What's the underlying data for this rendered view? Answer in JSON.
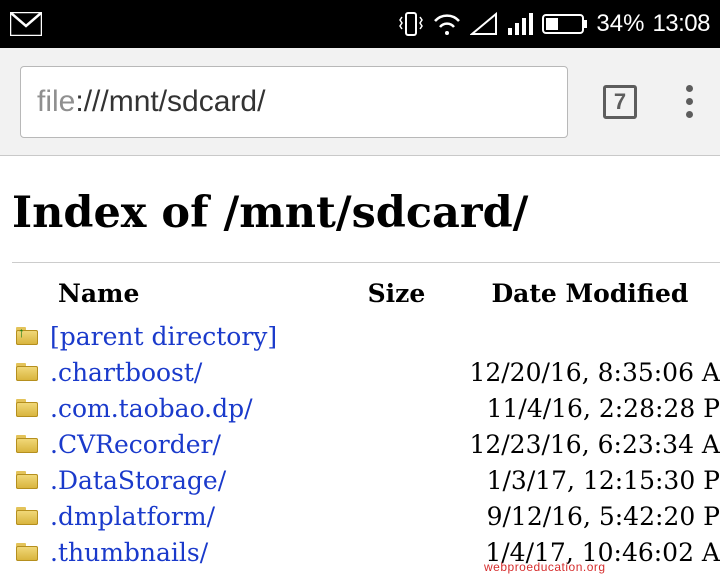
{
  "status": {
    "time": "13:08",
    "battery_pct": "34%"
  },
  "browser": {
    "url_scheme": "file",
    "url_rest": ":///mnt/sdcard/",
    "tab_count": "7"
  },
  "page": {
    "title": "Index of /mnt/sdcard/",
    "columns": {
      "name": "Name",
      "size": "Size",
      "date": "Date Modified"
    },
    "entries": [
      {
        "name": "[parent directory]",
        "size": "",
        "date": "",
        "parent": true
      },
      {
        "name": ".chartboost/",
        "size": "",
        "date": "12/20/16, 8:35:06 A"
      },
      {
        "name": ".com.taobao.dp/",
        "size": "",
        "date": "11/4/16, 2:28:28 P"
      },
      {
        "name": ".CVRecorder/",
        "size": "",
        "date": "12/23/16, 6:23:34 A"
      },
      {
        "name": ".DataStorage/",
        "size": "",
        "date": "1/3/17, 12:15:30 P"
      },
      {
        "name": ".dmplatform/",
        "size": "",
        "date": "9/12/16, 5:42:20 P"
      },
      {
        "name": ".thumbnails/",
        "size": "",
        "date": "1/4/17, 10:46:02 A"
      }
    ]
  },
  "watermark": "webproeducation.org"
}
